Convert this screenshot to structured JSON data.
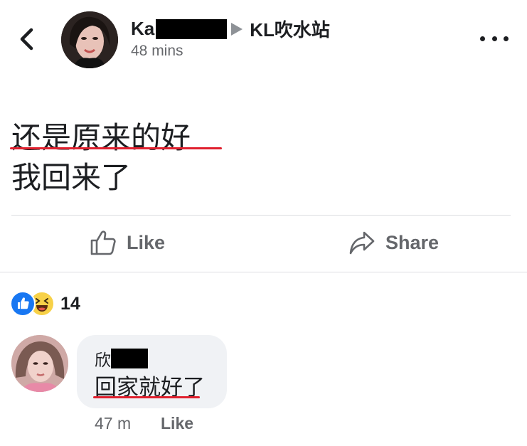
{
  "post": {
    "author_prefix": "Ka",
    "group_name": "KL吹水站",
    "timestamp": "48 mins",
    "text_lines": [
      "还是原来的好",
      "我回来了"
    ]
  },
  "actions": {
    "like_label": "Like",
    "share_label": "Share"
  },
  "reactions": {
    "count": "14",
    "types": [
      "like",
      "haha"
    ]
  },
  "comment": {
    "author_prefix": "欣",
    "text": "回家就好了",
    "time": "47 m",
    "like_label": "Like"
  },
  "colors": {
    "like_blue": "#1877f2",
    "haha_yellow": "#f7d148",
    "underline_red": "#e0202e",
    "muted_gray": "#65676b"
  },
  "icons": [
    "back-chevron-icon",
    "more-dots-icon",
    "thumbs-up-icon",
    "share-arrow-icon"
  ]
}
